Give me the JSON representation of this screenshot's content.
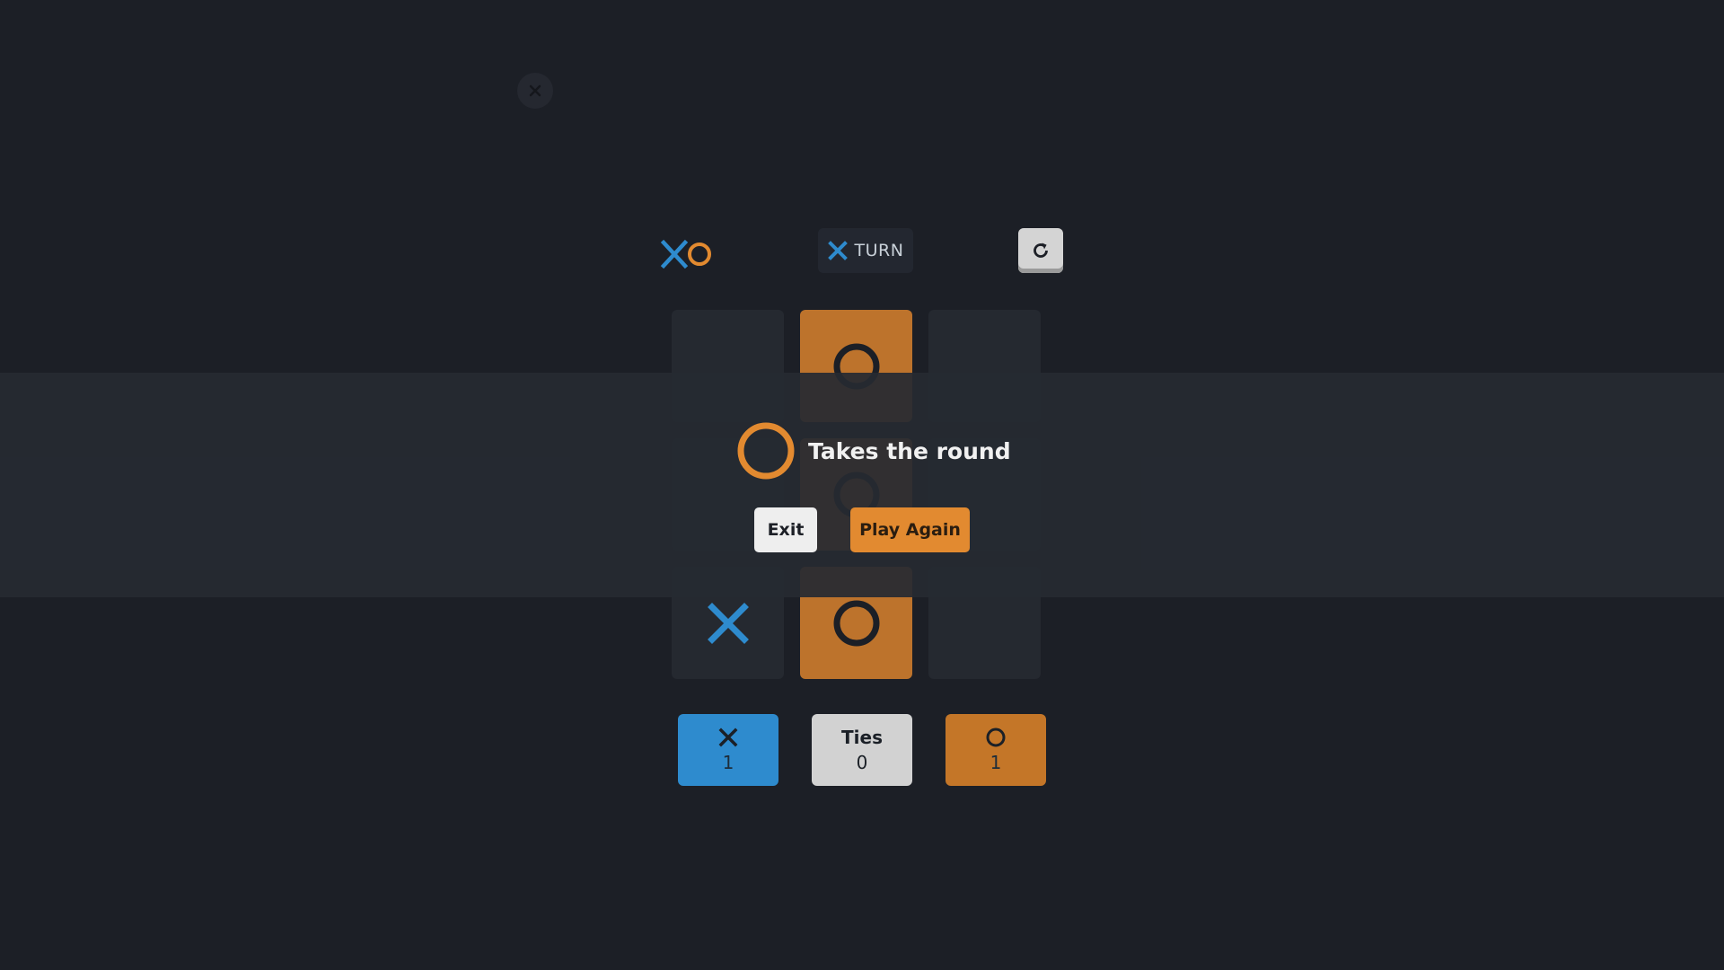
{
  "colors": {
    "background": "#1c1f26",
    "x_accent": "#2e8bce",
    "o_accent": "#e28a30",
    "ties": "#d2d2d2"
  },
  "top": {
    "close_icon": "close-icon"
  },
  "header": {
    "logo_icons": [
      "x-icon",
      "o-icon"
    ],
    "turn": {
      "icon": "x-icon",
      "label": "TURN"
    },
    "restart_icon": "restart-icon"
  },
  "board": {
    "cells": [
      "",
      "O",
      "",
      "",
      "O",
      "",
      "X",
      "O",
      ""
    ],
    "winning_cells": [
      1,
      4,
      7
    ]
  },
  "scores": {
    "x": {
      "icon": "x-icon",
      "value": "1"
    },
    "ties": {
      "label": "Ties",
      "value": "0"
    },
    "o": {
      "icon": "o-icon",
      "value": "1"
    }
  },
  "result_modal": {
    "winner_icon": "o-icon",
    "message": "Takes the round",
    "exit_label": "Exit",
    "play_again_label": "Play Again"
  }
}
